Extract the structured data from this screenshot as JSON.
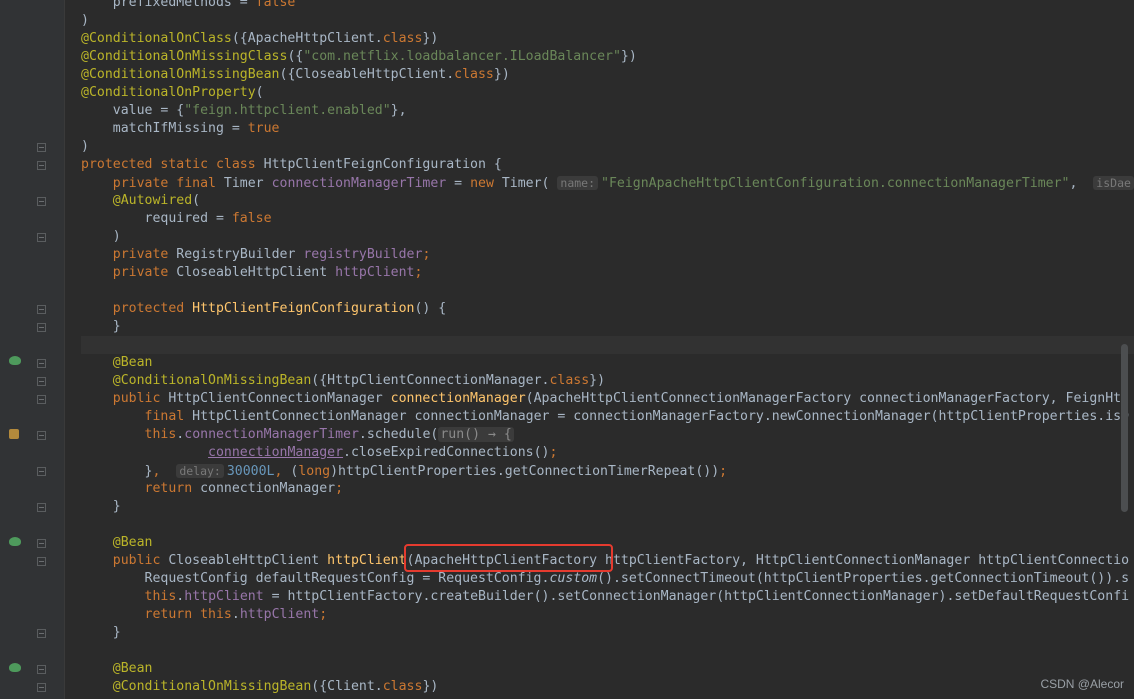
{
  "editor": {
    "lines": [
      "    prefixedMethods = false",
      ")",
      "@ConditionalOnClass({ApacheHttpClient.class})",
      "@ConditionalOnMissingClass({\"com.netflix.loadbalancer.ILoadBalancer\"})",
      "@ConditionalOnMissingBean({CloseableHttpClient.class})",
      "@ConditionalOnProperty(",
      "    value = {\"feign.httpclient.enabled\"},",
      "    matchIfMissing = true",
      ")",
      "protected static class HttpClientFeignConfiguration {",
      "    private final Timer connectionManagerTimer = new Timer( name: \"FeignApacheHttpClientConfiguration.connectionManagerTimer\",  isDae",
      "    @Autowired(",
      "        required = false",
      "    )",
      "    private RegistryBuilder registryBuilder;",
      "    private CloseableHttpClient httpClient;",
      "",
      "    protected HttpClientFeignConfiguration() {",
      "    }",
      "",
      "    @Bean",
      "    @ConditionalOnMissingBean({HttpClientConnectionManager.class})",
      "    public HttpClientConnectionManager connectionManager(ApacheHttpClientConnectionManagerFactory connectionManagerFactory, FeignHtt",
      "        final HttpClientConnectionManager connectionManager = connectionManagerFactory.newConnectionManager(httpClientProperties.isD",
      "        this.connectionManagerTimer.schedule(run() → {",
      "                connectionManager.closeExpiredConnections();",
      "        },  delay: 30000L, (long)httpClientProperties.getConnectionTimerRepeat());",
      "        return connectionManager;",
      "    }",
      "",
      "    @Bean",
      "    public CloseableHttpClient httpClient(ApacheHttpClientFactory httpClientFactory, HttpClientConnectionManager httpClientConnectio",
      "        RequestConfig defaultRequestConfig = RequestConfig.custom().setConnectTimeout(httpClientProperties.getConnectionTimeout()).s",
      "        this.httpClient = httpClientFactory.createBuilder().setConnectionManager(httpClientConnectionManager).setDefaultRequestConfi",
      "        return this.httpClient;",
      "    }",
      "",
      "    @Bean",
      "    @ConditionalOnMissingBean({Client.class})"
    ]
  },
  "hints": {
    "timer_name_label": "name:",
    "delay_label": "delay:",
    "daemon_label": "isDae"
  },
  "watermark": "CSDN @Alecor",
  "colors": {
    "background": "#2b2b2b",
    "keyword": "#cc7832",
    "annotation": "#bbb529",
    "string": "#6a8759",
    "field": "#9876aa",
    "method": "#ffc66d",
    "number": "#6897bb",
    "highlight_box": "#e53b2f"
  },
  "icons": [
    "spring-bean-icon",
    "fold-marker-icon",
    "implementation-marker-icon"
  ]
}
